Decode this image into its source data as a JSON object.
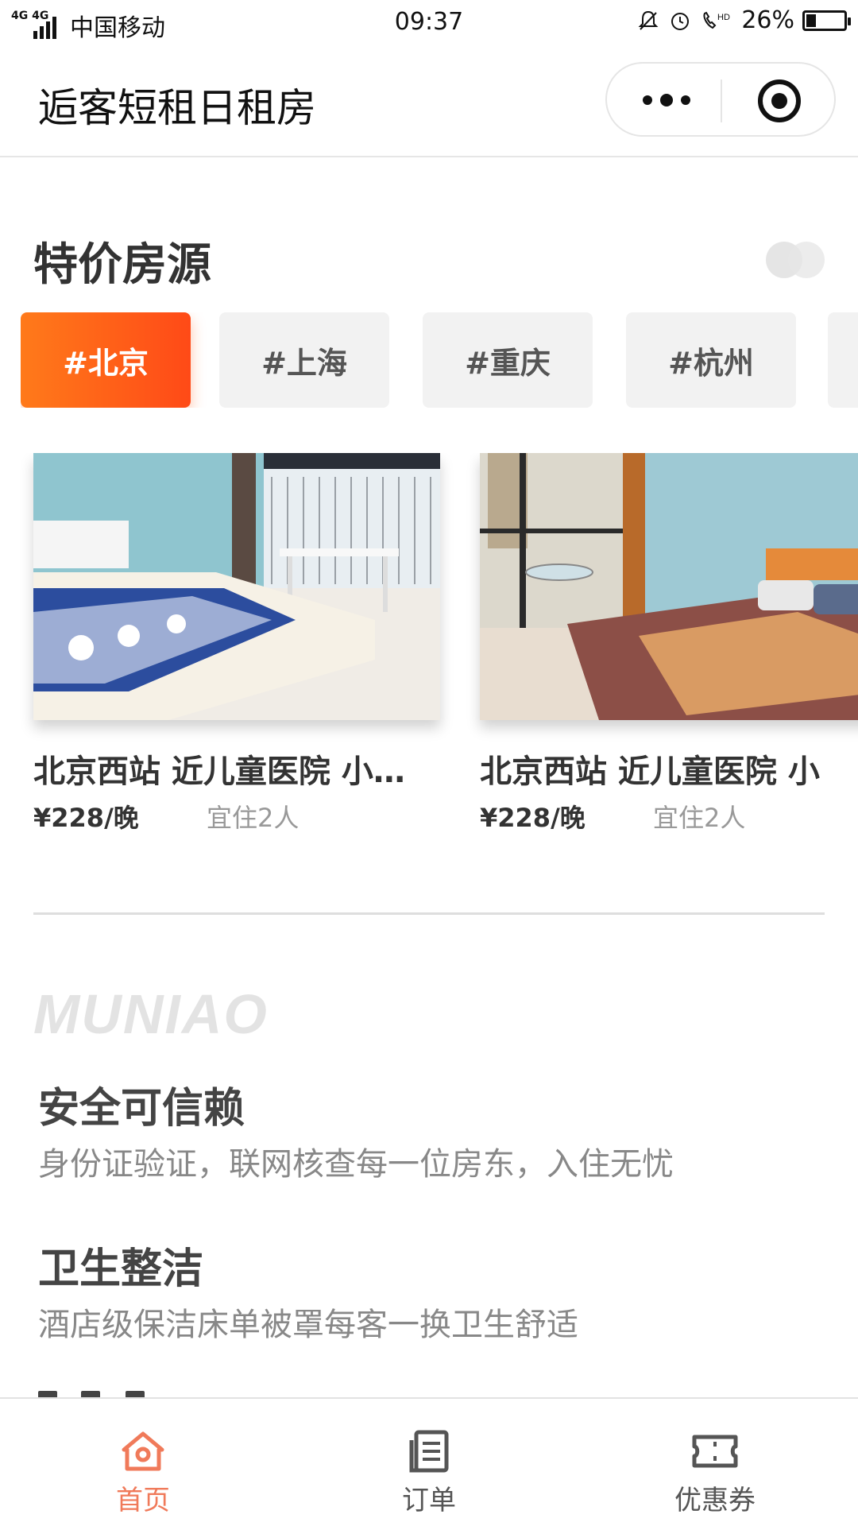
{
  "status_bar": {
    "network": "4G 4G",
    "carrier": "中国移动",
    "time": "09:37",
    "battery": "26%",
    "battery_level": 0.26,
    "icons": [
      "bell-off-icon",
      "alarm-icon",
      "hd-call-icon"
    ]
  },
  "nav": {
    "title": "逅客短租日租房",
    "more_icon": "more-dots-icon",
    "close_icon": "target-close-icon"
  },
  "section": {
    "title": "特价房源"
  },
  "city_tabs": [
    {
      "label": "#北京",
      "active": true
    },
    {
      "label": "#上海",
      "active": false
    },
    {
      "label": "#重庆",
      "active": false
    },
    {
      "label": "#杭州",
      "active": false
    }
  ],
  "listings": [
    {
      "title": "北京西站 近儿童医院 小…",
      "price": "¥228/晚",
      "guests": "宜住2人"
    },
    {
      "title": "北京西站 近儿童医院 小",
      "price": "¥228/晚",
      "guests": "宜住2人"
    }
  ],
  "brand": "MUNIAO",
  "features": [
    {
      "title": "安全可信赖",
      "desc": "身份证验证，联网核查每一位房东，入住无忧"
    },
    {
      "title": "卫生整洁",
      "desc": "酒店级保洁床单被罩每客一换卫生舒适"
    }
  ],
  "tab_bar": [
    {
      "label": "首页",
      "icon": "home-icon",
      "active": true
    },
    {
      "label": "订单",
      "icon": "order-list-icon",
      "active": false
    },
    {
      "label": "优惠券",
      "icon": "coupon-ticket-icon",
      "active": false
    }
  ],
  "colors": {
    "accent": "#ff5a1a",
    "tab_active": "#f07a5a"
  }
}
